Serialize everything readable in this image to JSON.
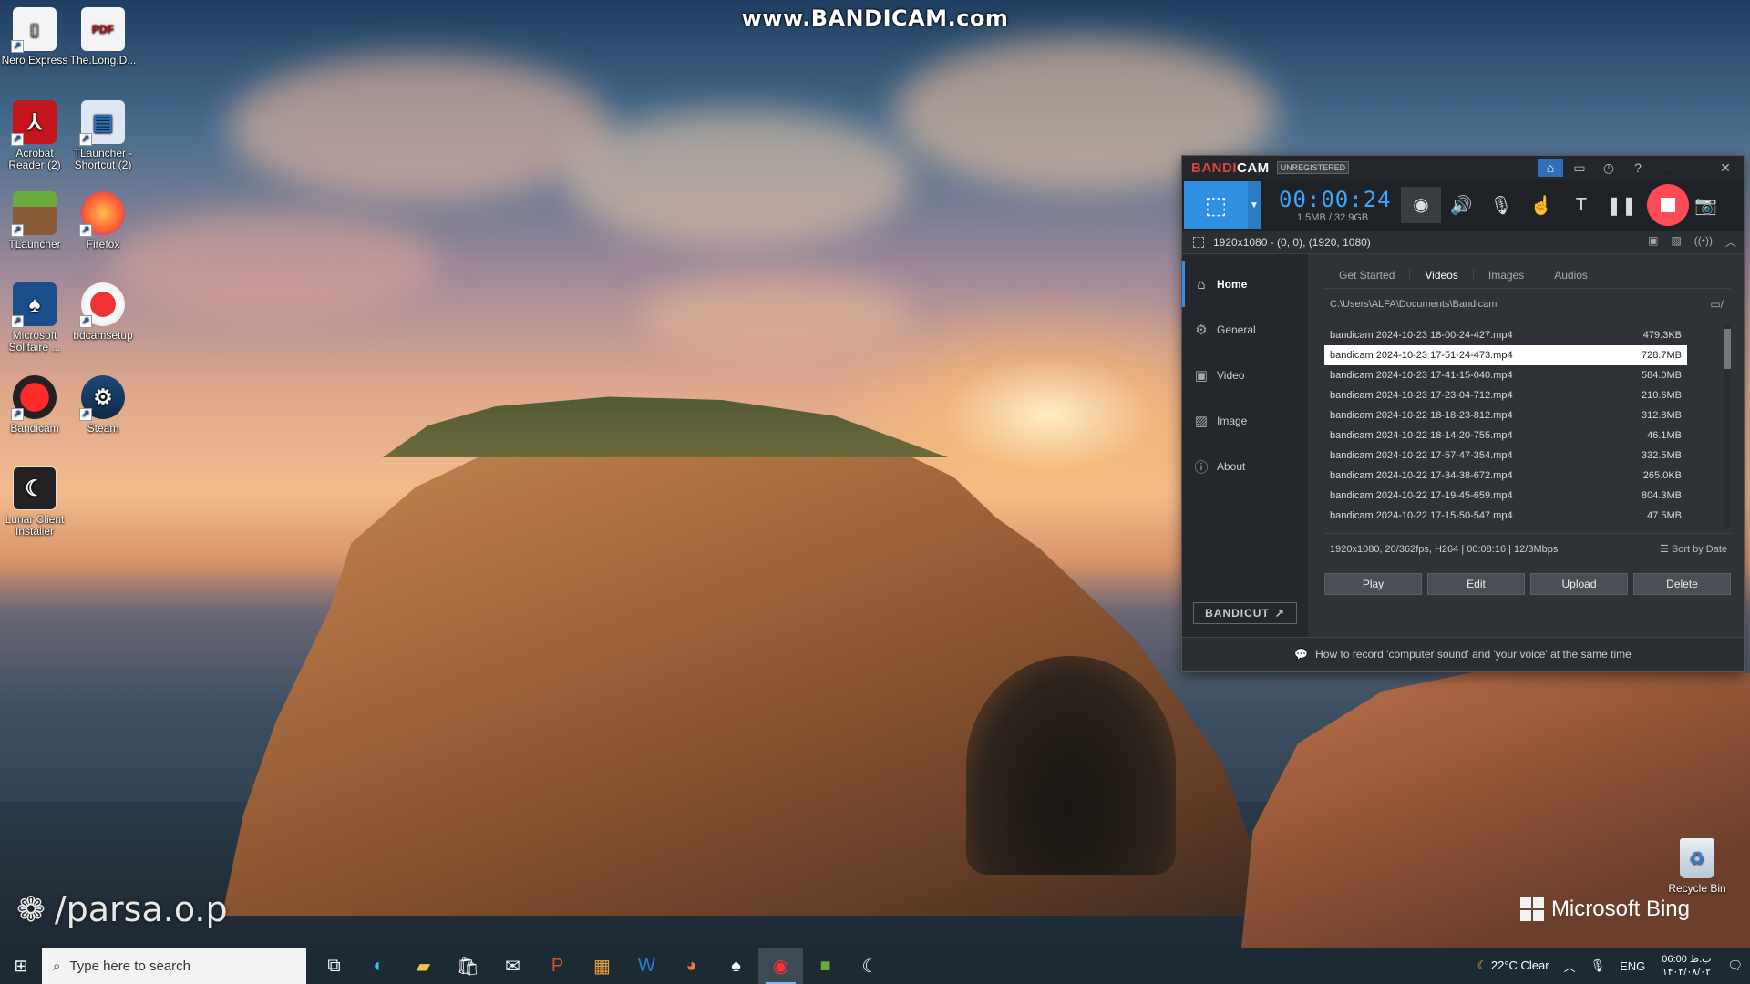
{
  "watermark": "www.BANDICAM.com",
  "overlay": {
    "handle": "/parsa.o.p",
    "bing": "Microsoft Bing"
  },
  "desktop": {
    "icons": [
      {
        "label": "Nero Express"
      },
      {
        "label": "The.Long.D..."
      },
      {
        "label": "Acrobat Reader (2)"
      },
      {
        "label": "TLauncher - Shortcut (2)"
      },
      {
        "label": "TLauncher"
      },
      {
        "label": "Firefox"
      },
      {
        "label": "Microsoft Solitaire ..."
      },
      {
        "label": "bdcamsetup"
      },
      {
        "label": "Bandicam"
      },
      {
        "label": "Steam"
      },
      {
        "label": "Lunar Client Installer"
      }
    ],
    "recycle_bin": "Recycle Bin"
  },
  "bandicam": {
    "brand_a": "BANDI",
    "brand_b": "CAM",
    "badge": "UNREGISTERED",
    "timer": "00:00:24",
    "size": "1.5MB / 32.9GB",
    "area": "1920x1080 - (0, 0), (1920, 1080)",
    "sidebar": [
      {
        "label": "Home"
      },
      {
        "label": "General"
      },
      {
        "label": "Video"
      },
      {
        "label": "Image"
      },
      {
        "label": "About"
      }
    ],
    "bandicut": "BANDICUT",
    "tabs": [
      {
        "label": "Get Started"
      },
      {
        "label": "Videos"
      },
      {
        "label": "Images"
      },
      {
        "label": "Audios"
      }
    ],
    "path": "C:\\Users\\ALFA\\Documents\\Bandicam",
    "files": [
      {
        "name": "bandicam 2024-10-23 18-00-24-427.mp4",
        "size": "479.3KB"
      },
      {
        "name": "bandicam 2024-10-23 17-51-24-473.mp4",
        "size": "728.7MB"
      },
      {
        "name": "bandicam 2024-10-23 17-41-15-040.mp4",
        "size": "584.0MB"
      },
      {
        "name": "bandicam 2024-10-23 17-23-04-712.mp4",
        "size": "210.6MB"
      },
      {
        "name": "bandicam 2024-10-22 18-18-23-812.mp4",
        "size": "312.8MB"
      },
      {
        "name": "bandicam 2024-10-22 18-14-20-755.mp4",
        "size": "46.1MB"
      },
      {
        "name": "bandicam 2024-10-22 17-57-47-354.mp4",
        "size": "332.5MB"
      },
      {
        "name": "bandicam 2024-10-22 17-34-38-672.mp4",
        "size": "265.0KB"
      },
      {
        "name": "bandicam 2024-10-22 17-19-45-659.mp4",
        "size": "804.3MB"
      },
      {
        "name": "bandicam 2024-10-22 17-15-50-547.mp4",
        "size": "47.5MB"
      }
    ],
    "file_info": "1920x1080, 20/362fps, H264 | 00:08:16 | 12/3Mbps",
    "sort": "Sort by Date",
    "actions": {
      "play": "Play",
      "edit": "Edit",
      "upload": "Upload",
      "delete": "Delete"
    },
    "tip": "How to record 'computer sound' and 'your voice' at the same time"
  },
  "taskbar": {
    "search_placeholder": "Type here to search",
    "weather": "22°C  Clear",
    "lang": "ENG",
    "time": "06:00 ب.ظ",
    "date": "۱۴۰۳/۰۸/۰۲"
  }
}
